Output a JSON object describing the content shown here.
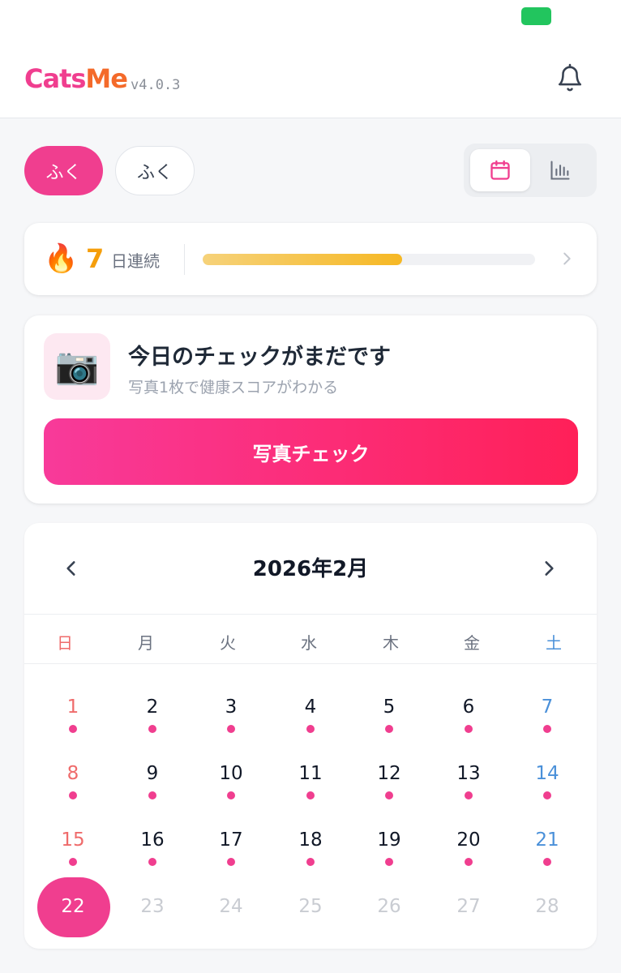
{
  "app": {
    "brand_part1": "Cats",
    "brand_part2": "Me",
    "version": "v4.0.3"
  },
  "pets": [
    {
      "label": "ふく",
      "active": true
    },
    {
      "label": "ふく",
      "active": false
    }
  ],
  "view_toggle": {
    "selected": "calendar",
    "icons": [
      "calendar-icon",
      "bar-chart-icon"
    ]
  },
  "streak": {
    "icon": "🔥",
    "days": "7",
    "label": "日連続",
    "progress": 0.6
  },
  "check": {
    "icon": "📷",
    "title": "今日のチェックがまだです",
    "subtitle": "写真1枚で健康スコアがわかる",
    "button_label": "写真チェック"
  },
  "calendar": {
    "month_label": "2026年2月",
    "weekdays": [
      "日",
      "月",
      "火",
      "水",
      "木",
      "金",
      "土"
    ],
    "today": "22",
    "days": [
      {
        "n": "1",
        "dot": true
      },
      {
        "n": "2",
        "dot": true
      },
      {
        "n": "3",
        "dot": true
      },
      {
        "n": "4",
        "dot": true
      },
      {
        "n": "5",
        "dot": true
      },
      {
        "n": "6",
        "dot": true
      },
      {
        "n": "7",
        "dot": true
      },
      {
        "n": "8",
        "dot": true
      },
      {
        "n": "9",
        "dot": true
      },
      {
        "n": "10",
        "dot": true
      },
      {
        "n": "11",
        "dot": true
      },
      {
        "n": "12",
        "dot": true
      },
      {
        "n": "13",
        "dot": true
      },
      {
        "n": "14",
        "dot": true
      },
      {
        "n": "15",
        "dot": true
      },
      {
        "n": "16",
        "dot": true
      },
      {
        "n": "17",
        "dot": true
      },
      {
        "n": "18",
        "dot": true
      },
      {
        "n": "19",
        "dot": true
      },
      {
        "n": "20",
        "dot": true
      },
      {
        "n": "21",
        "dot": true
      },
      {
        "n": "22",
        "dot": false
      },
      {
        "n": "23",
        "dot": false
      },
      {
        "n": "24",
        "dot": false
      },
      {
        "n": "25",
        "dot": false
      },
      {
        "n": "26",
        "dot": false
      },
      {
        "n": "27",
        "dot": false
      },
      {
        "n": "28",
        "dot": false
      }
    ]
  },
  "colors": {
    "accent": "#f03e8f",
    "accent_orange": "#f46a2a",
    "streak": "#f59e0b",
    "sunday": "#ef6b6b",
    "saturday": "#4a90d9"
  }
}
